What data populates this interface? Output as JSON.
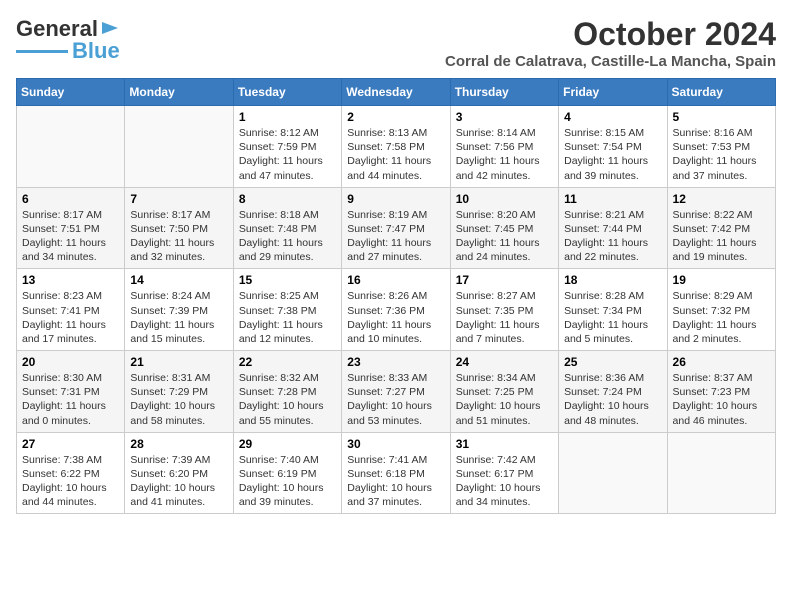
{
  "logo": {
    "line1": "General",
    "line2": "Blue"
  },
  "title": "October 2024",
  "location": "Corral de Calatrava, Castille-La Mancha, Spain",
  "days_of_week": [
    "Sunday",
    "Monday",
    "Tuesday",
    "Wednesday",
    "Thursday",
    "Friday",
    "Saturday"
  ],
  "weeks": [
    [
      {
        "day": "",
        "info": ""
      },
      {
        "day": "",
        "info": ""
      },
      {
        "day": "1",
        "info": "Sunrise: 8:12 AM\nSunset: 7:59 PM\nDaylight: 11 hours and 47 minutes."
      },
      {
        "day": "2",
        "info": "Sunrise: 8:13 AM\nSunset: 7:58 PM\nDaylight: 11 hours and 44 minutes."
      },
      {
        "day": "3",
        "info": "Sunrise: 8:14 AM\nSunset: 7:56 PM\nDaylight: 11 hours and 42 minutes."
      },
      {
        "day": "4",
        "info": "Sunrise: 8:15 AM\nSunset: 7:54 PM\nDaylight: 11 hours and 39 minutes."
      },
      {
        "day": "5",
        "info": "Sunrise: 8:16 AM\nSunset: 7:53 PM\nDaylight: 11 hours and 37 minutes."
      }
    ],
    [
      {
        "day": "6",
        "info": "Sunrise: 8:17 AM\nSunset: 7:51 PM\nDaylight: 11 hours and 34 minutes."
      },
      {
        "day": "7",
        "info": "Sunrise: 8:17 AM\nSunset: 7:50 PM\nDaylight: 11 hours and 32 minutes."
      },
      {
        "day": "8",
        "info": "Sunrise: 8:18 AM\nSunset: 7:48 PM\nDaylight: 11 hours and 29 minutes."
      },
      {
        "day": "9",
        "info": "Sunrise: 8:19 AM\nSunset: 7:47 PM\nDaylight: 11 hours and 27 minutes."
      },
      {
        "day": "10",
        "info": "Sunrise: 8:20 AM\nSunset: 7:45 PM\nDaylight: 11 hours and 24 minutes."
      },
      {
        "day": "11",
        "info": "Sunrise: 8:21 AM\nSunset: 7:44 PM\nDaylight: 11 hours and 22 minutes."
      },
      {
        "day": "12",
        "info": "Sunrise: 8:22 AM\nSunset: 7:42 PM\nDaylight: 11 hours and 19 minutes."
      }
    ],
    [
      {
        "day": "13",
        "info": "Sunrise: 8:23 AM\nSunset: 7:41 PM\nDaylight: 11 hours and 17 minutes."
      },
      {
        "day": "14",
        "info": "Sunrise: 8:24 AM\nSunset: 7:39 PM\nDaylight: 11 hours and 15 minutes."
      },
      {
        "day": "15",
        "info": "Sunrise: 8:25 AM\nSunset: 7:38 PM\nDaylight: 11 hours and 12 minutes."
      },
      {
        "day": "16",
        "info": "Sunrise: 8:26 AM\nSunset: 7:36 PM\nDaylight: 11 hours and 10 minutes."
      },
      {
        "day": "17",
        "info": "Sunrise: 8:27 AM\nSunset: 7:35 PM\nDaylight: 11 hours and 7 minutes."
      },
      {
        "day": "18",
        "info": "Sunrise: 8:28 AM\nSunset: 7:34 PM\nDaylight: 11 hours and 5 minutes."
      },
      {
        "day": "19",
        "info": "Sunrise: 8:29 AM\nSunset: 7:32 PM\nDaylight: 11 hours and 2 minutes."
      }
    ],
    [
      {
        "day": "20",
        "info": "Sunrise: 8:30 AM\nSunset: 7:31 PM\nDaylight: 11 hours and 0 minutes."
      },
      {
        "day": "21",
        "info": "Sunrise: 8:31 AM\nSunset: 7:29 PM\nDaylight: 10 hours and 58 minutes."
      },
      {
        "day": "22",
        "info": "Sunrise: 8:32 AM\nSunset: 7:28 PM\nDaylight: 10 hours and 55 minutes."
      },
      {
        "day": "23",
        "info": "Sunrise: 8:33 AM\nSunset: 7:27 PM\nDaylight: 10 hours and 53 minutes."
      },
      {
        "day": "24",
        "info": "Sunrise: 8:34 AM\nSunset: 7:25 PM\nDaylight: 10 hours and 51 minutes."
      },
      {
        "day": "25",
        "info": "Sunrise: 8:36 AM\nSunset: 7:24 PM\nDaylight: 10 hours and 48 minutes."
      },
      {
        "day": "26",
        "info": "Sunrise: 8:37 AM\nSunset: 7:23 PM\nDaylight: 10 hours and 46 minutes."
      }
    ],
    [
      {
        "day": "27",
        "info": "Sunrise: 7:38 AM\nSunset: 6:22 PM\nDaylight: 10 hours and 44 minutes."
      },
      {
        "day": "28",
        "info": "Sunrise: 7:39 AM\nSunset: 6:20 PM\nDaylight: 10 hours and 41 minutes."
      },
      {
        "day": "29",
        "info": "Sunrise: 7:40 AM\nSunset: 6:19 PM\nDaylight: 10 hours and 39 minutes."
      },
      {
        "day": "30",
        "info": "Sunrise: 7:41 AM\nSunset: 6:18 PM\nDaylight: 10 hours and 37 minutes."
      },
      {
        "day": "31",
        "info": "Sunrise: 7:42 AM\nSunset: 6:17 PM\nDaylight: 10 hours and 34 minutes."
      },
      {
        "day": "",
        "info": ""
      },
      {
        "day": "",
        "info": ""
      }
    ]
  ]
}
